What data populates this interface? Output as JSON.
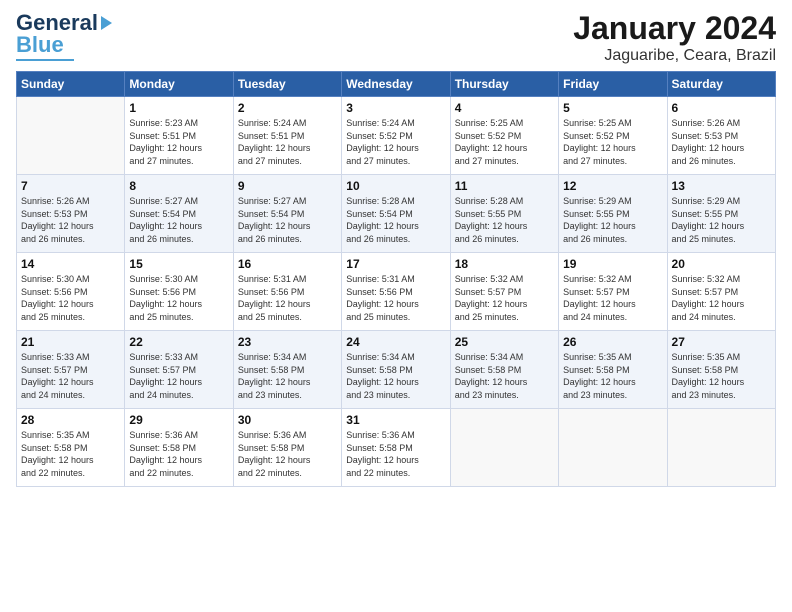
{
  "header": {
    "logo_line1": "General",
    "logo_line2": "Blue",
    "month": "January 2024",
    "location": "Jaguaribe, Ceara, Brazil"
  },
  "weekdays": [
    "Sunday",
    "Monday",
    "Tuesday",
    "Wednesday",
    "Thursday",
    "Friday",
    "Saturday"
  ],
  "weeks": [
    [
      {
        "day": "",
        "sunrise": "",
        "sunset": "",
        "daylight": ""
      },
      {
        "day": "1",
        "sunrise": "5:23 AM",
        "sunset": "5:51 PM",
        "daylight": "12 hours and 27 minutes."
      },
      {
        "day": "2",
        "sunrise": "5:24 AM",
        "sunset": "5:51 PM",
        "daylight": "12 hours and 27 minutes."
      },
      {
        "day": "3",
        "sunrise": "5:24 AM",
        "sunset": "5:52 PM",
        "daylight": "12 hours and 27 minutes."
      },
      {
        "day": "4",
        "sunrise": "5:25 AM",
        "sunset": "5:52 PM",
        "daylight": "12 hours and 27 minutes."
      },
      {
        "day": "5",
        "sunrise": "5:25 AM",
        "sunset": "5:52 PM",
        "daylight": "12 hours and 27 minutes."
      },
      {
        "day": "6",
        "sunrise": "5:26 AM",
        "sunset": "5:53 PM",
        "daylight": "12 hours and 26 minutes."
      }
    ],
    [
      {
        "day": "7",
        "sunrise": "5:26 AM",
        "sunset": "5:53 PM",
        "daylight": "12 hours and 26 minutes."
      },
      {
        "day": "8",
        "sunrise": "5:27 AM",
        "sunset": "5:54 PM",
        "daylight": "12 hours and 26 minutes."
      },
      {
        "day": "9",
        "sunrise": "5:27 AM",
        "sunset": "5:54 PM",
        "daylight": "12 hours and 26 minutes."
      },
      {
        "day": "10",
        "sunrise": "5:28 AM",
        "sunset": "5:54 PM",
        "daylight": "12 hours and 26 minutes."
      },
      {
        "day": "11",
        "sunrise": "5:28 AM",
        "sunset": "5:55 PM",
        "daylight": "12 hours and 26 minutes."
      },
      {
        "day": "12",
        "sunrise": "5:29 AM",
        "sunset": "5:55 PM",
        "daylight": "12 hours and 26 minutes."
      },
      {
        "day": "13",
        "sunrise": "5:29 AM",
        "sunset": "5:55 PM",
        "daylight": "12 hours and 25 minutes."
      }
    ],
    [
      {
        "day": "14",
        "sunrise": "5:30 AM",
        "sunset": "5:56 PM",
        "daylight": "12 hours and 25 minutes."
      },
      {
        "day": "15",
        "sunrise": "5:30 AM",
        "sunset": "5:56 PM",
        "daylight": "12 hours and 25 minutes."
      },
      {
        "day": "16",
        "sunrise": "5:31 AM",
        "sunset": "5:56 PM",
        "daylight": "12 hours and 25 minutes."
      },
      {
        "day": "17",
        "sunrise": "5:31 AM",
        "sunset": "5:56 PM",
        "daylight": "12 hours and 25 minutes."
      },
      {
        "day": "18",
        "sunrise": "5:32 AM",
        "sunset": "5:57 PM",
        "daylight": "12 hours and 25 minutes."
      },
      {
        "day": "19",
        "sunrise": "5:32 AM",
        "sunset": "5:57 PM",
        "daylight": "12 hours and 24 minutes."
      },
      {
        "day": "20",
        "sunrise": "5:32 AM",
        "sunset": "5:57 PM",
        "daylight": "12 hours and 24 minutes."
      }
    ],
    [
      {
        "day": "21",
        "sunrise": "5:33 AM",
        "sunset": "5:57 PM",
        "daylight": "12 hours and 24 minutes."
      },
      {
        "day": "22",
        "sunrise": "5:33 AM",
        "sunset": "5:57 PM",
        "daylight": "12 hours and 24 minutes."
      },
      {
        "day": "23",
        "sunrise": "5:34 AM",
        "sunset": "5:58 PM",
        "daylight": "12 hours and 23 minutes."
      },
      {
        "day": "24",
        "sunrise": "5:34 AM",
        "sunset": "5:58 PM",
        "daylight": "12 hours and 23 minutes."
      },
      {
        "day": "25",
        "sunrise": "5:34 AM",
        "sunset": "5:58 PM",
        "daylight": "12 hours and 23 minutes."
      },
      {
        "day": "26",
        "sunrise": "5:35 AM",
        "sunset": "5:58 PM",
        "daylight": "12 hours and 23 minutes."
      },
      {
        "day": "27",
        "sunrise": "5:35 AM",
        "sunset": "5:58 PM",
        "daylight": "12 hours and 23 minutes."
      }
    ],
    [
      {
        "day": "28",
        "sunrise": "5:35 AM",
        "sunset": "5:58 PM",
        "daylight": "12 hours and 22 minutes."
      },
      {
        "day": "29",
        "sunrise": "5:36 AM",
        "sunset": "5:58 PM",
        "daylight": "12 hours and 22 minutes."
      },
      {
        "day": "30",
        "sunrise": "5:36 AM",
        "sunset": "5:58 PM",
        "daylight": "12 hours and 22 minutes."
      },
      {
        "day": "31",
        "sunrise": "5:36 AM",
        "sunset": "5:58 PM",
        "daylight": "12 hours and 22 minutes."
      },
      {
        "day": "",
        "sunrise": "",
        "sunset": "",
        "daylight": ""
      },
      {
        "day": "",
        "sunrise": "",
        "sunset": "",
        "daylight": ""
      },
      {
        "day": "",
        "sunrise": "",
        "sunset": "",
        "daylight": ""
      }
    ]
  ]
}
